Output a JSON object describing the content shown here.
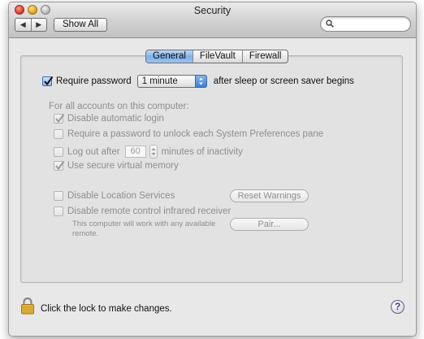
{
  "window": {
    "title": "Security",
    "nav_back": "◀",
    "nav_forward": "▶",
    "show_all": "Show All",
    "search_placeholder": ""
  },
  "tabs": [
    {
      "label": "General",
      "active": true
    },
    {
      "label": "FileVault",
      "active": false
    },
    {
      "label": "Firewall",
      "active": false
    }
  ],
  "general": {
    "require_password": {
      "label": "Require password",
      "checked": true
    },
    "password_delay": "1 minute",
    "password_suffix": "after sleep or screen saver begins",
    "section_heading": "For all accounts on this computer:",
    "options": {
      "disable_autologin": {
        "label": "Disable automatic login",
        "checked": true,
        "enabled": false
      },
      "require_password_prefs": {
        "label": "Require a password to unlock each System Preferences pane",
        "checked": false,
        "enabled": false
      },
      "logout_prefix": "Log out after",
      "logout_minutes": "60",
      "logout_suffix": "minutes of inactivity",
      "secure_vm": {
        "label": "Use secure virtual memory",
        "checked": true,
        "enabled": false
      },
      "disable_location": {
        "label": "Disable Location Services",
        "checked": false,
        "enabled": false
      },
      "disable_ir": {
        "label": "Disable remote control infrared receiver",
        "checked": false,
        "enabled": false
      }
    },
    "reset_warnings": "Reset Warnings",
    "pair": "Pair...",
    "ir_note": "This computer will work with any available remote."
  },
  "footer": {
    "lock_text": "Click the lock to make changes.",
    "help": "?"
  },
  "colors": {
    "accent_tab": "#7fb0e8",
    "popup_arrows": "#3c7ed8",
    "disabled_text": "#8e8e8e"
  },
  "icons": [
    "close-icon",
    "minimize-icon",
    "zoom-icon",
    "search-icon",
    "checkmark-icon",
    "lock-icon",
    "help-icon"
  ]
}
